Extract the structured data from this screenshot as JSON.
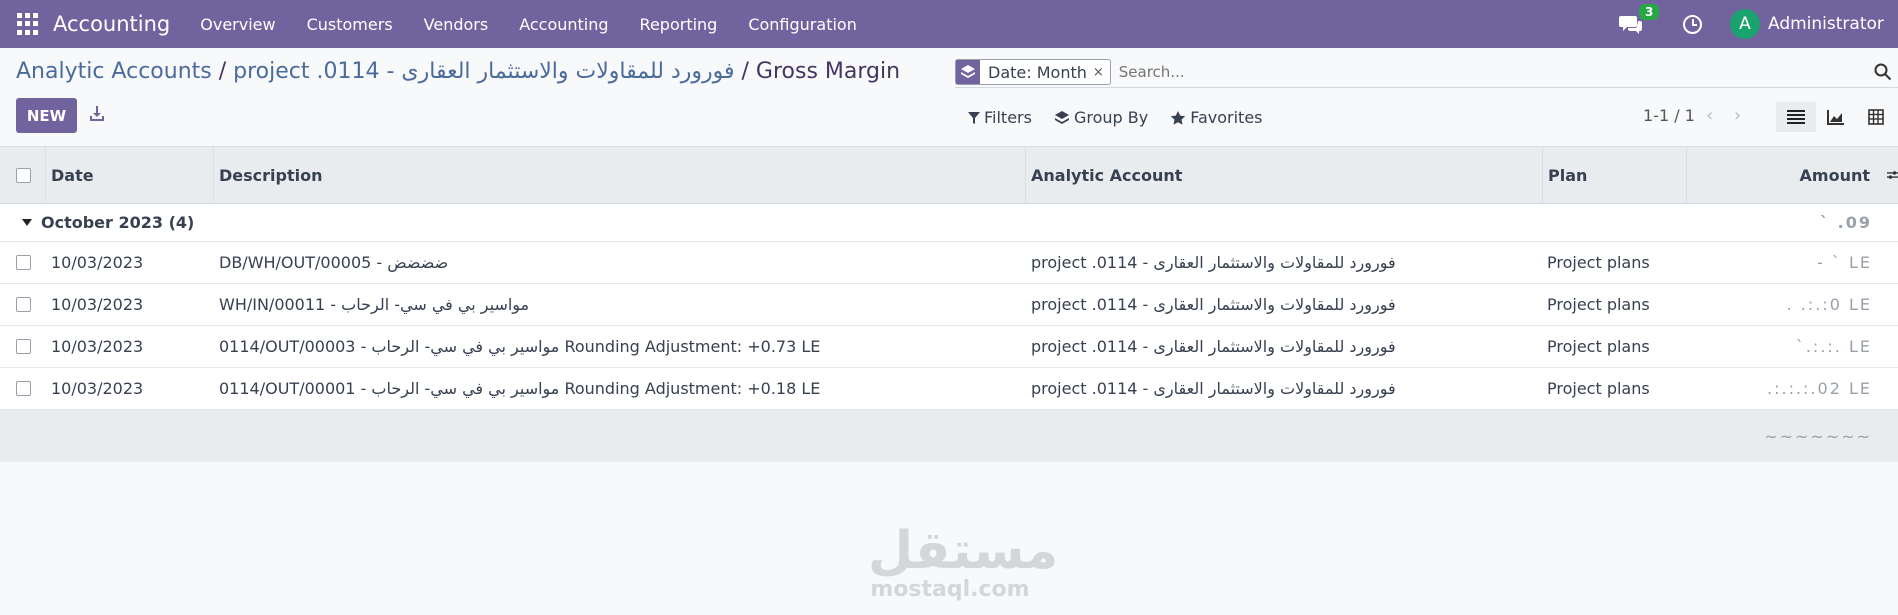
{
  "navbar": {
    "brand": "Accounting",
    "menu": [
      "Overview",
      "Customers",
      "Vendors",
      "Accounting",
      "Reporting",
      "Configuration"
    ],
    "chat_count": "3",
    "avatar_letter": "A",
    "user_name": "Administrator"
  },
  "breadcrumb": {
    "parent": "Analytic Accounts",
    "separator": " / ",
    "account": "project .0114 - فورورد للمقاولات والاستثمار العقارى",
    "current": "Gross Margin"
  },
  "toolbar": {
    "new_label": "NEW"
  },
  "search": {
    "facet_label": "Date: Month",
    "facet_close": "×",
    "placeholder": "Search..."
  },
  "filters": {
    "filters_label": "Filters",
    "groupby_label": "Group By",
    "favorites_label": "Favorites"
  },
  "pager": {
    "text": "1-1 / 1"
  },
  "table": {
    "columns": [
      "Date",
      "Description",
      "Analytic Account",
      "Plan",
      "Amount"
    ],
    "group": {
      "label": "October 2023 (4)",
      "total": "` .09"
    },
    "rows": [
      {
        "date": "10/03/2023",
        "description": "DB/WH/OUT/00005 - ضضضض",
        "account": "project .0114 - فورورد للمقاولات والاستثمار العقارى",
        "plan": "Project plans",
        "amount": "- ` LE"
      },
      {
        "date": "10/03/2023",
        "description": "WH/IN/00011 - مواسير بي في سي- الرحاب",
        "account": "project .0114 - فورورد للمقاولات والاستثمار العقارى",
        "plan": "Project plans",
        "amount": ". .:.:0 LE"
      },
      {
        "date": "10/03/2023",
        "description": "0114/OUT/00003 - مواسير بي في سي- الرحاب Rounding Adjustment: +0.73 LE",
        "account": "project .0114 - فورورد للمقاولات والاستثمار العقارى",
        "plan": "Project plans",
        "amount": "`.:.:. LE"
      },
      {
        "date": "10/03/2023",
        "description": "0114/OUT/00001 - مواسير بي في سي- الرحاب Rounding Adjustment: +0.18 LE",
        "account": "project .0114 - فورورد للمقاولات والاستثمار العقارى",
        "plan": "Project plans",
        "amount": ".:.:.:.02 LE"
      }
    ],
    "footer_total": "~~~~~~~"
  },
  "watermark": {
    "arabic": "مستقل",
    "latin": "mostaql.com"
  },
  "colors": {
    "brand": "#71639e",
    "badge": "#28a745",
    "avatar": "#1aa36f"
  }
}
